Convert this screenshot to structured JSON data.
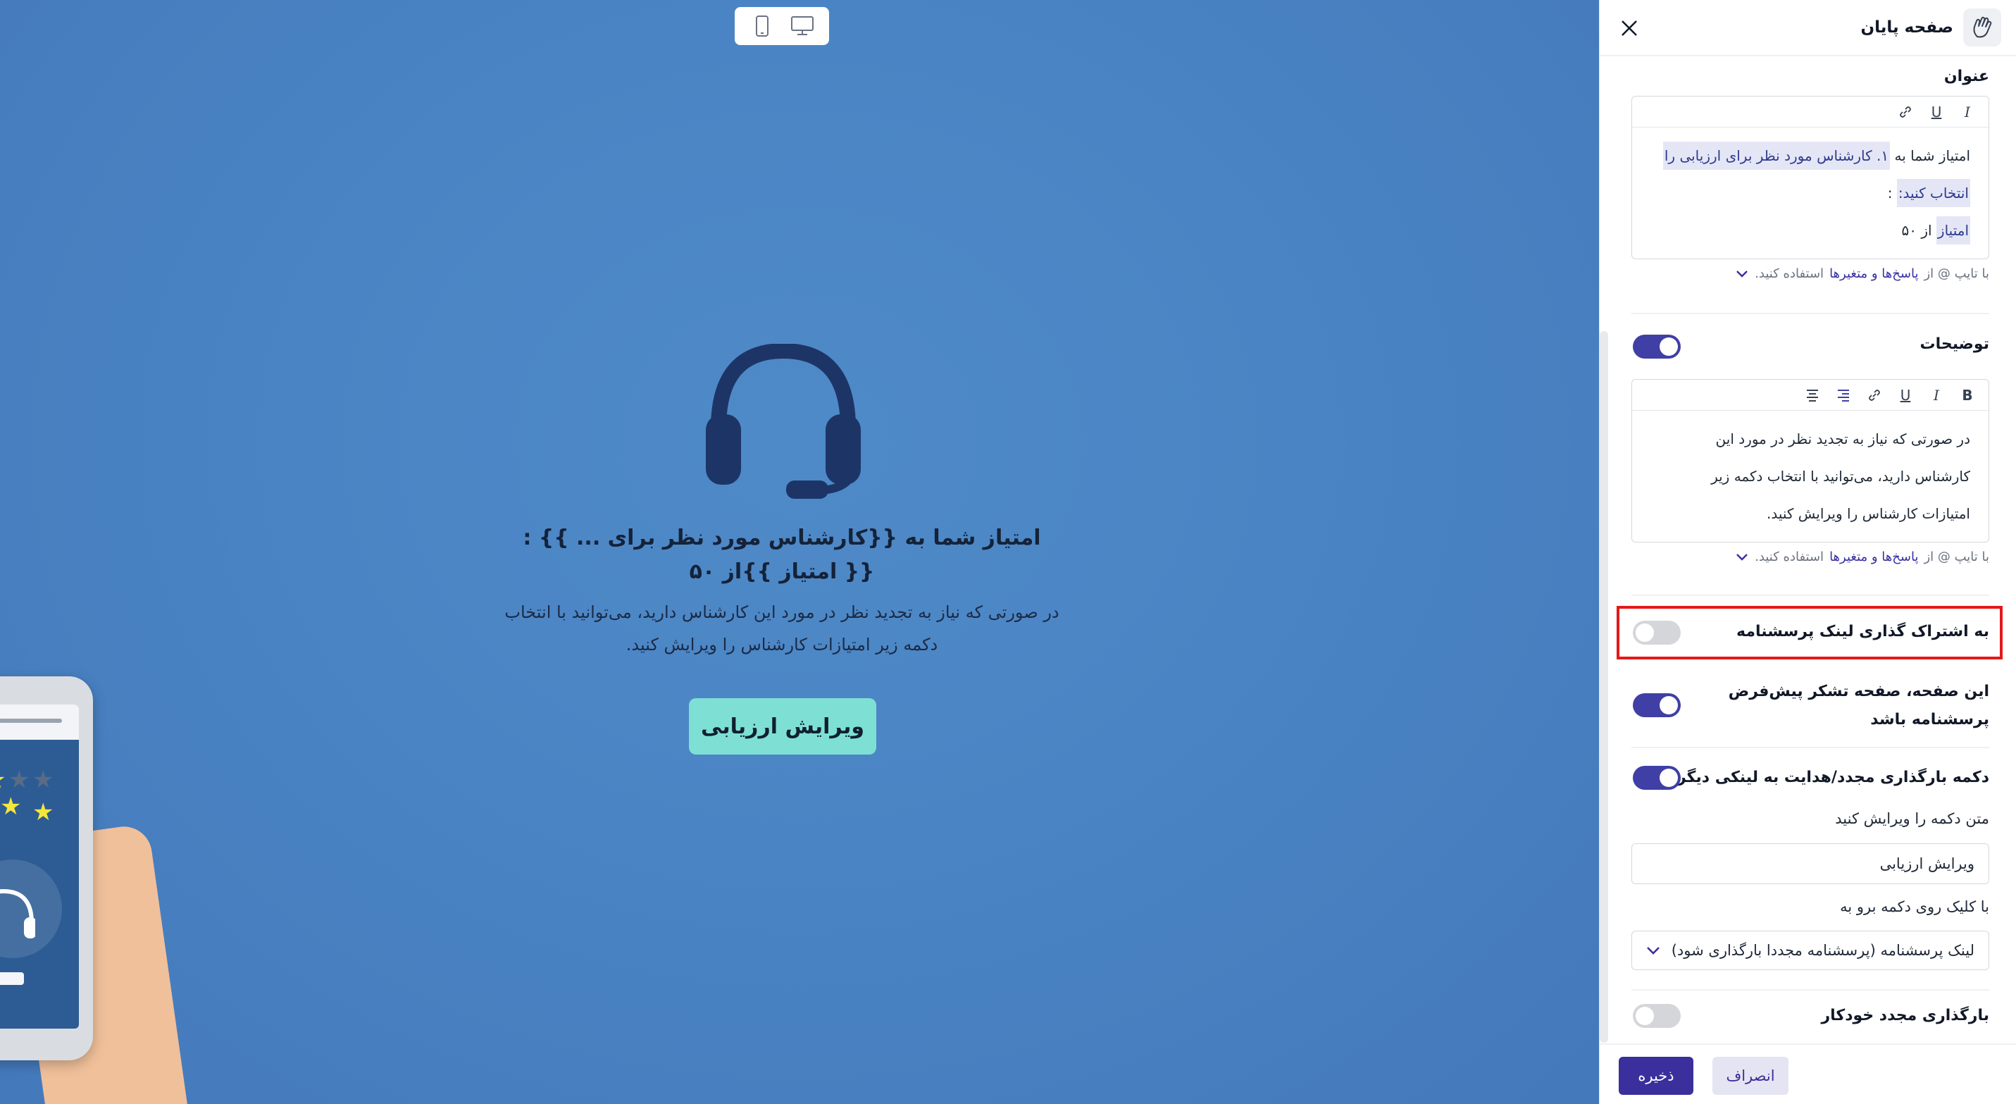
{
  "canvas": {
    "background": "#4a84c4",
    "device_toggle": {
      "mobile_icon": "mobile-icon",
      "desktop_icon": "desktop-icon"
    },
    "headset_icon": "headset-icon",
    "title_line1": "امتیاز شما به {{کارشناس مورد نظر برای ... }} :",
    "title_line2": "{{ امتیاز }}از ۵۰",
    "description_line1": "در صورتی که نیاز به تجدید نظر در مورد این کارشناس دارید، می‌توانید با انتخاب",
    "description_line2": "دکمه زیر امتیازات کارشناس را ویرایش کنید.",
    "button_label": "ویرایش ارزیابی",
    "button_color": "#7ee0d4"
  },
  "panel": {
    "header": {
      "title": "صفحه پایان",
      "icon": "waving-hand-icon",
      "close_icon": "close-icon"
    },
    "title_section": {
      "label": "عنوان",
      "line1_prefix": "امتیاز شما به",
      "line1_chip": "۱. کارشناس مورد نظر برای ارزیابی را",
      "line2_chip": "انتخاب کنید:",
      "line2_suffix": ":",
      "line3_chip": "امتیاز",
      "line3_suffix": "از ۵۰"
    },
    "hint": {
      "prefix": "با تایپ @ از",
      "link": "پاسخ‌ها و متغیرها",
      "suffix": "استفاده کنید."
    },
    "description_section": {
      "label": "توضیحات",
      "enabled": true,
      "line1": "در صورتی که نیاز به تجدید نظر در مورد این",
      "line2": "کارشناس دارید، می‌توانید با انتخاب دکمه زیر",
      "line3": "امتیازات کارشناس را ویرایش کنید."
    },
    "share_link": {
      "label": "به اشتراک گذاری لینک پرسشنامه",
      "enabled": false
    },
    "default_thanks": {
      "line1": "این صفحه، صفحه تشکر پیش‌فرض",
      "line2": "پرسشنامه باشد",
      "enabled": true
    },
    "reload_button": {
      "label": "دکمه بارگذاری مجدد/هدایت به لینکی دیگر",
      "enabled": true
    },
    "button_text": {
      "label": "متن دکمه را ویرایش کنید",
      "value": "ویرایش ارزیابی"
    },
    "on_click": {
      "label": "با کلیک روی دکمه برو به",
      "selected": "لینک پرسشنامه (پرسشنامه مجددا بارگذاری شود)"
    },
    "auto_reload": {
      "label": "بارگذاری مجدد خودکار",
      "enabled": false
    },
    "footer": {
      "save": "ذخیره",
      "cancel": "انصراف"
    },
    "accent": "#3f3fa6",
    "highlight_color": "#e31919"
  }
}
